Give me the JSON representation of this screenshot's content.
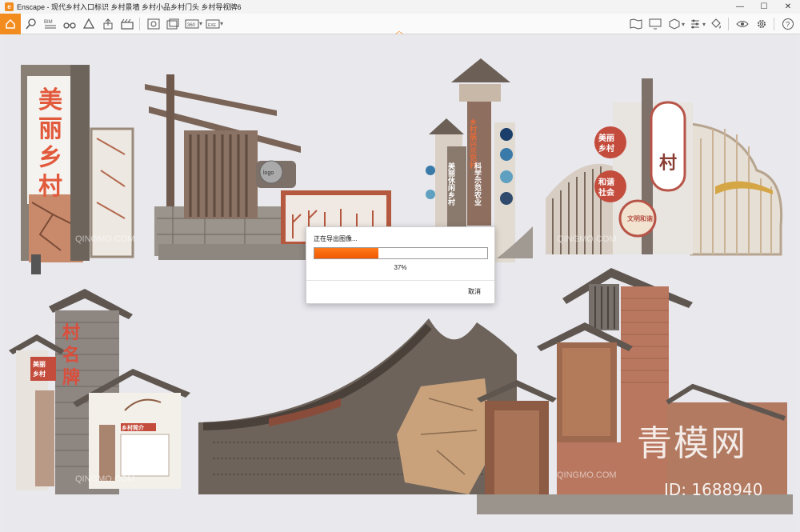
{
  "window": {
    "title": "Enscape - 现代乡村入口标识 乡村景墙 乡村小品乡村门头 乡村导视牌6",
    "app_logo_letter": "e"
  },
  "dialog": {
    "title": "正在导出图像...",
    "progress_percent": 37,
    "progress_text": "37%",
    "cancel_label": "取消"
  },
  "signs": {
    "s1": "美丽乡村",
    "s3_logo": "logo",
    "s4_vertical": "乡村振兴示范村",
    "s4_side": "美丽休闲乡村",
    "s4_side2": "科学示范农业",
    "s5_top_left": "美丽乡村",
    "s5_bottom_left": "和谐社会",
    "s5_center": "村",
    "s5_small": "文明和谐",
    "s6_vertical": "村名牌",
    "s6_badge": "美丽乡村",
    "s6_panel": "乡村简介"
  },
  "watermark": {
    "big": "青模网",
    "id": "ID: 1688940",
    "small": "QINGMO.COM"
  }
}
